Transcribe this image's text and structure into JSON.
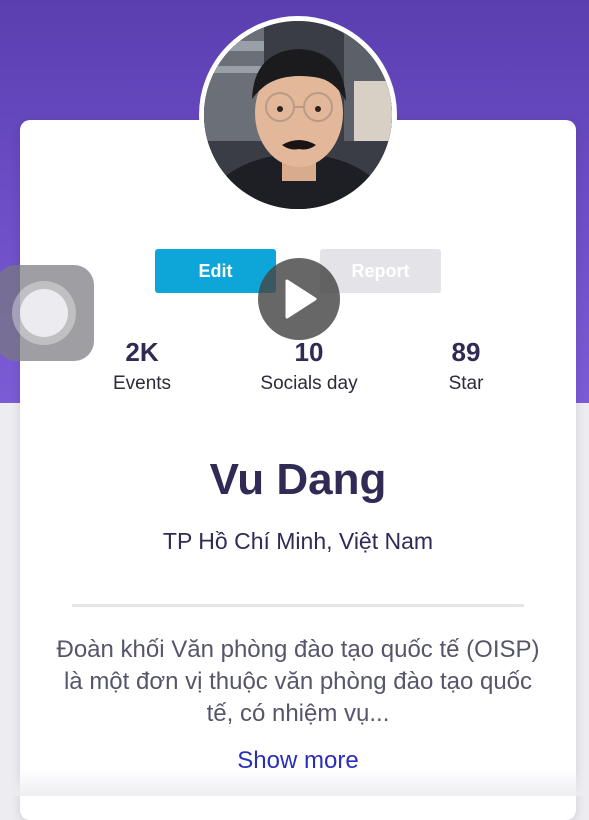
{
  "profile": {
    "name": "Vu Dang",
    "location": "TP Hồ Chí Minh, Việt Nam",
    "bio": "Đoàn khối Văn phòng đào tạo quốc tế (OISP) là một đơn vị thuộc văn phòng đào tạo quốc tế, có nhiệm vụ...",
    "show_more_label": "Show more"
  },
  "actions": {
    "edit_label": "Edit",
    "report_label": "Report"
  },
  "stats": [
    {
      "value": "2K",
      "label": "Events"
    },
    {
      "value": "10",
      "label": "Socials day"
    },
    {
      "value": "89",
      "label": "Star"
    }
  ],
  "colors": {
    "header_gradient_top": "#5a3fb0",
    "header_gradient_bottom": "#7c5cd6",
    "edit_button": "#0ea5d8",
    "report_button": "#e4e3e8",
    "name_text": "#2f2b55",
    "link_text": "#2a2fb8"
  },
  "icons": {
    "play": "play-icon",
    "assistive_touch": "assistive-touch-icon"
  }
}
